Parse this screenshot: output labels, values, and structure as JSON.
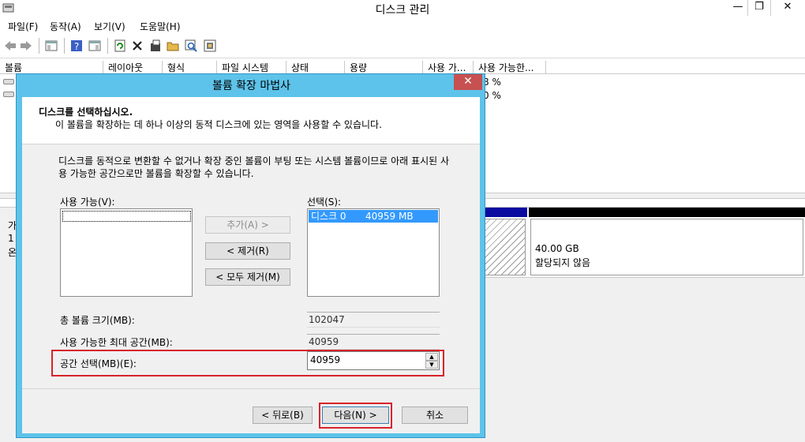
{
  "window": {
    "title": "디스크 관리",
    "min_glyph": "—",
    "max_glyph": "❐",
    "close_glyph": "✕"
  },
  "menu": {
    "file": "파일(F)",
    "action": "동작(A)",
    "view": "보기(V)",
    "help": "도움말(H)"
  },
  "toolbar": {
    "icons": [
      "back-arrow-icon",
      "forward-arrow-icon",
      "console-tree-icon",
      "help-icon",
      "properties-pane-icon",
      "refresh-icon",
      "delete-icon",
      "properties-icon",
      "open-folder-icon",
      "find-icon",
      "export-icon"
    ]
  },
  "columns": [
    "볼륨",
    "레이아웃",
    "형식",
    "파일 시스템",
    "상태",
    "용량",
    "사용 가...",
    "사용 가능한..."
  ],
  "volumes": {
    "row1_pct": "8 %",
    "row2_pct": "0 %"
  },
  "disk_graph": {
    "left_chars": [
      "가",
      "1",
      "온"
    ],
    "unalloc_size": "40.00 GB",
    "unalloc_label": "할당되지 않음"
  },
  "dialog": {
    "title": "볼륨 확장 마법사",
    "close_glyph": "✕",
    "header_title": "디스크를 선택하십시오.",
    "header_sub": "이 볼륨을 확장하는 데 하나 이상의 동적 디스크에 있는 영역을 사용할 수 있습니다.",
    "description": "디스크를 동적으로 변환할 수 없거나 확장 중인 볼륨이 부팅 또는 시스템 볼륨이므로 아래 표시된 사용 가능한 공간으로만 볼륨을 확장할 수 있습니다.",
    "available_label": "사용 가능(V):",
    "selected_label": "선택(S):",
    "selected_item_name": "디스크 0",
    "selected_item_size": "40959 MB",
    "add_button": "추가(A) >",
    "remove_button": "< 제거(R)",
    "remove_all_button": "< 모두 제거(M)",
    "total_size_label": "총 볼륨 크기(MB):",
    "total_size_value": "102047",
    "max_space_label": "사용 가능한 최대 공간(MB):",
    "max_space_value": "40959",
    "space_select_label": "공간 선택(MB)(E):",
    "space_select_value": "40959",
    "back_button": "< 뒤로(B)",
    "next_button": "다음(N) >",
    "cancel_button": "취소"
  }
}
